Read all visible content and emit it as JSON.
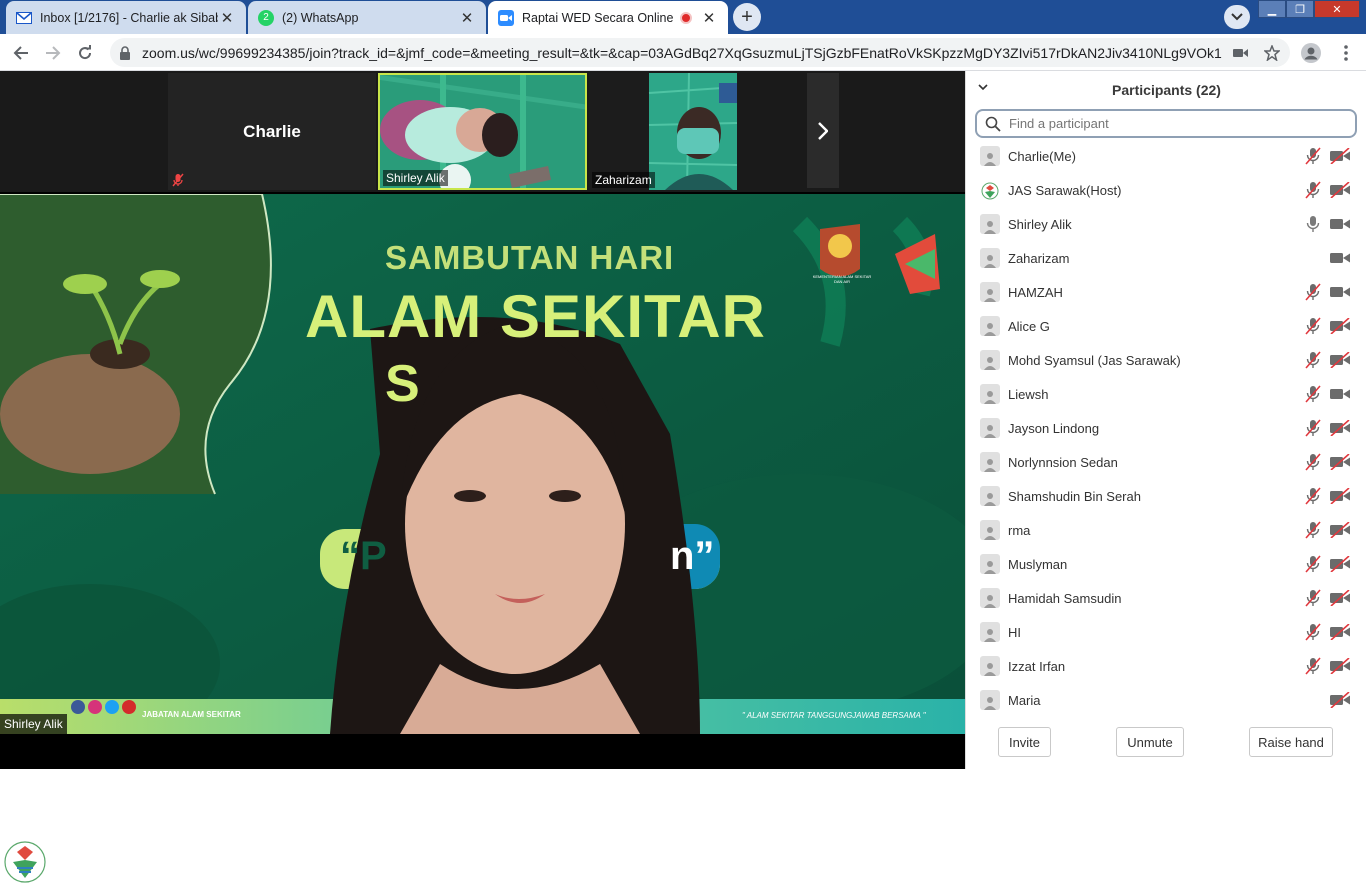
{
  "tabs": [
    {
      "title": "Inbox [1/2176] - Charlie ak Sibab",
      "icon": "mail-icon",
      "active": false
    },
    {
      "title": "(2) WhatsApp",
      "icon": "whatsapp-icon",
      "active": false
    },
    {
      "title": "Raptai WED Secara Online",
      "icon": "zoom-icon",
      "active": true
    }
  ],
  "newtab_label": "+",
  "address": {
    "url": "zoom.us/wc/99699234385/join?track_id=&jmf_code=&meeting_result=&tk=&cap=03AGdBq27XqGsuzmuLjTSjGzbFEnatRoVkSKpzzMgDY3ZIvi517rDkAN2Jiv3410NLg9VOk1..."
  },
  "meeting": {
    "thumbnails": [
      {
        "name": "Charlie",
        "muted": true,
        "video": false
      },
      {
        "name": "Shirley Alik",
        "active_speaker": true,
        "video": true
      },
      {
        "name": "Zaharizam",
        "video": true
      }
    ],
    "speaker_name": "Shirley Alik",
    "slide": {
      "line1": "SAMBUTAN HARI",
      "line2": "ALAM SEKITAR",
      "line3": "S",
      "quote_left": "“P",
      "quote_right": "n”",
      "social_handle": "JABATAN ALAM SEKITAR",
      "tagline": "\" ALAM SEKITAR TANGGUNGJAWAB BERSAMA \"",
      "ministry": "KEMENTERIAN ALAM SEKITAR DAN AIR"
    },
    "colors": {
      "slide_green": "#0f5e42",
      "lime": "#c8e87a"
    }
  },
  "participants_panel": {
    "title": "Participants (22)",
    "search_placeholder": "Find a participant",
    "participants": [
      {
        "name": "Charlie(Me)",
        "mic": "muted",
        "cam": "off"
      },
      {
        "name": "JAS Sarawak(Host)",
        "mic": "muted",
        "cam": "off",
        "avatar": "logo"
      },
      {
        "name": "Shirley Alik",
        "mic": "on",
        "cam": "on"
      },
      {
        "name": "Zaharizam",
        "mic": "none",
        "cam": "on"
      },
      {
        "name": "HAMZAH",
        "mic": "muted",
        "cam": "on"
      },
      {
        "name": "Alice G",
        "mic": "muted",
        "cam": "off"
      },
      {
        "name": "Mohd Syamsul (Jas Sarawak)",
        "mic": "muted",
        "cam": "off"
      },
      {
        "name": "Liewsh",
        "mic": "muted",
        "cam": "on"
      },
      {
        "name": "Jayson Lindong",
        "mic": "muted",
        "cam": "off"
      },
      {
        "name": "Norlynnsion Sedan",
        "mic": "muted",
        "cam": "off"
      },
      {
        "name": "Shamshudin Bin Serah",
        "mic": "muted",
        "cam": "off"
      },
      {
        "name": "rma",
        "mic": "muted",
        "cam": "off"
      },
      {
        "name": "Muslyman",
        "mic": "muted",
        "cam": "off"
      },
      {
        "name": "Hamidah Samsudin",
        "mic": "muted",
        "cam": "off"
      },
      {
        "name": "HI",
        "mic": "muted",
        "cam": "off"
      },
      {
        "name": "Izzat Irfan",
        "mic": "muted",
        "cam": "off"
      },
      {
        "name": "Maria",
        "mic": "none",
        "cam": "off"
      }
    ],
    "buttons": {
      "invite": "Invite",
      "unmute": "Unmute",
      "raise_hand": "Raise hand"
    }
  }
}
